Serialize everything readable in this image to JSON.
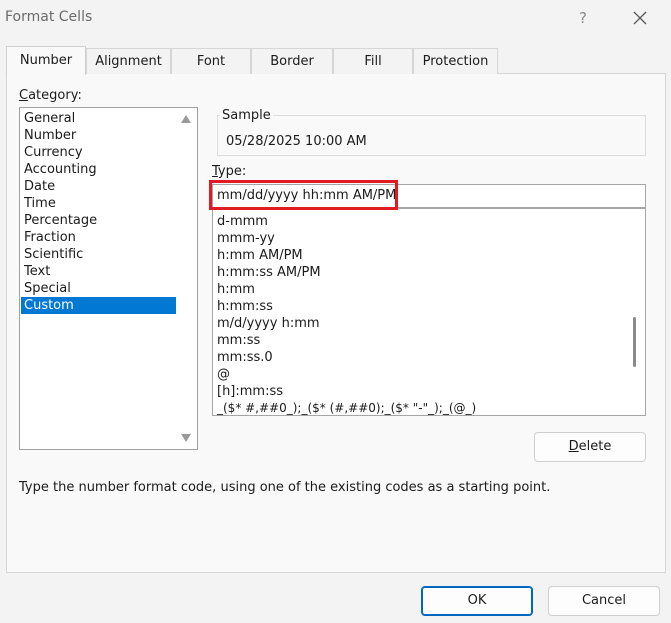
{
  "window": {
    "title": "Format Cells",
    "help_label": "?"
  },
  "tabs": [
    {
      "label": "Number",
      "active": true
    },
    {
      "label": "Alignment"
    },
    {
      "label": "Font"
    },
    {
      "label": "Border"
    },
    {
      "label": "Fill"
    },
    {
      "label": "Protection"
    }
  ],
  "category": {
    "label_prefix": "C",
    "label_rest": "ategory:",
    "items": [
      "General",
      "Number",
      "Currency",
      "Accounting",
      "Date",
      "Time",
      "Percentage",
      "Fraction",
      "Scientific",
      "Text",
      "Special",
      "Custom"
    ],
    "selected": "Custom"
  },
  "sample": {
    "label": "Sample",
    "value": "05/28/2025 10:00 AM"
  },
  "type": {
    "label_prefix": "T",
    "label_rest": "ype:",
    "value": "mm/dd/yyyy hh:mm AM/PM"
  },
  "formats": [
    "d-mmm",
    "mmm-yy",
    "h:mm AM/PM",
    "h:mm:ss AM/PM",
    "h:mm",
    "h:mm:ss",
    "m/d/yyyy h:mm",
    "mm:ss",
    "mm:ss.0",
    "@",
    "[h]:mm:ss",
    "_($* #,##0_);_($* (#,##0);_($* \"-\"_);_(@_)"
  ],
  "buttons": {
    "delete_prefix": "D",
    "delete_rest": "elete",
    "ok": "OK",
    "cancel": "Cancel"
  },
  "hint": "Type the number format code, using one of the existing codes as a starting point.",
  "colors": {
    "accent": "#0078d4",
    "highlight": "#e01b24"
  }
}
